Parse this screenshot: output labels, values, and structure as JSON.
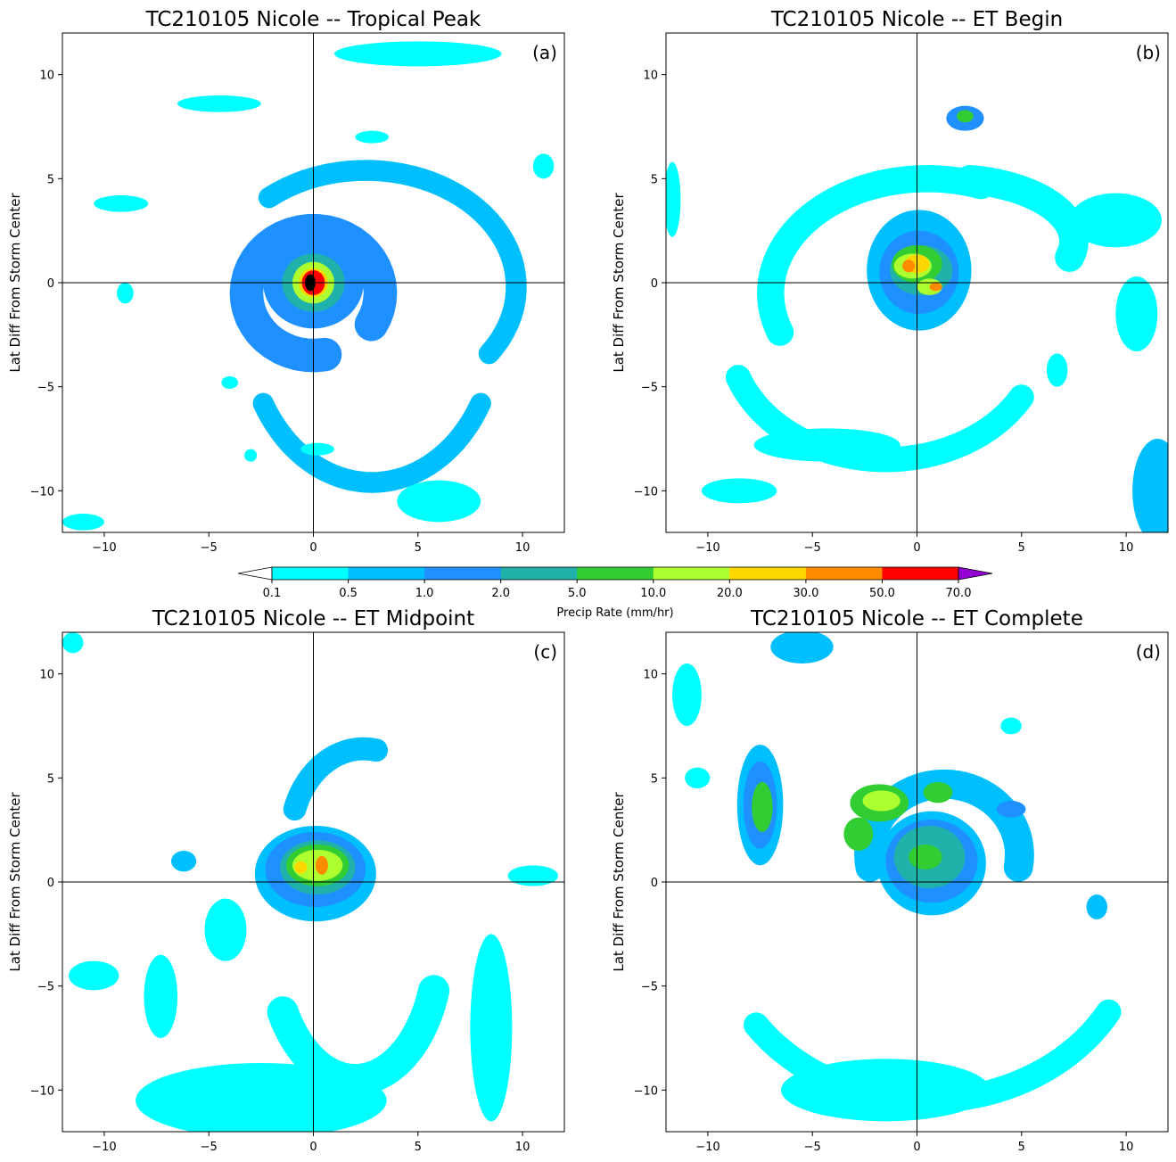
{
  "chart_data": {
    "type": "contour",
    "colorbar": {
      "label": "Precip Rate (mm/hr)",
      "levels": [
        "0.1",
        "0.5",
        "1.0",
        "2.0",
        "5.0",
        "10.0",
        "20.0",
        "30.0",
        "50.0",
        "70.0"
      ],
      "colors": [
        "#00ffff",
        "#00bfff",
        "#1e90ff",
        "#20b2aa",
        "#32cd32",
        "#adff2f",
        "#ffd700",
        "#ff8c00",
        "#ff0000"
      ],
      "under_color": "#ffffff",
      "over_color": "#9400d3",
      "extend": "both"
    },
    "panels": [
      {
        "title": "TC210105 Nicole -- Tropical Peak",
        "letter": "(a)",
        "ylabel": "Lat Diff From Storm Center",
        "xlim": [
          -12,
          12
        ],
        "ylim": [
          -12,
          12
        ],
        "xticks": [
          "−10",
          "−5",
          "0",
          "5",
          "10"
        ],
        "yticks": [
          "10",
          "5",
          "0",
          "−5",
          "−10"
        ],
        "features": [
          {
            "kind": "ring",
            "cx": 0,
            "cy": -0.5,
            "rx": 3.2,
            "ry": 3.0,
            "w": 1.6,
            "a0": -30,
            "a1": 280,
            "level": 2
          },
          {
            "kind": "ring",
            "cx": 2.5,
            "cy": -0.2,
            "rx": 7.2,
            "ry": 5.6,
            "w": 1.0,
            "a0": -35,
            "a1": 130,
            "level": 1
          },
          {
            "kind": "ring",
            "cx": 2.8,
            "cy": -2.0,
            "rx": 6.0,
            "ry": 7.6,
            "w": 1.0,
            "a0": 210,
            "a1": 330,
            "level": 1
          },
          {
            "kind": "blob",
            "cx": 0,
            "cy": 0,
            "rx": 2.4,
            "ry": 2.2,
            "level": 2
          },
          {
            "kind": "blob",
            "cx": 0,
            "cy": 0,
            "rx": 1.5,
            "ry": 1.4,
            "level": 3
          },
          {
            "kind": "blob",
            "cx": 0,
            "cy": 0,
            "rx": 1.0,
            "ry": 1.0,
            "level": 5
          },
          {
            "kind": "blob",
            "cx": 0,
            "cy": 0,
            "rx": 0.7,
            "ry": 0.7,
            "level": 6
          },
          {
            "kind": "blob",
            "cx": 0,
            "cy": 0,
            "rx": 0.55,
            "ry": 0.6,
            "level": 8
          },
          {
            "kind": "blob",
            "cx": -0.15,
            "cy": 0,
            "rx": 0.25,
            "ry": 0.4,
            "level": 9
          },
          {
            "kind": "blob",
            "cx": -4.5,
            "cy": 8.6,
            "rx": 2.0,
            "ry": 0.4,
            "level": 0
          },
          {
            "kind": "blob",
            "cx": 2.8,
            "cy": 7.0,
            "rx": 0.8,
            "ry": 0.3,
            "level": 0
          },
          {
            "kind": "blob",
            "cx": -9.2,
            "cy": 3.8,
            "rx": 1.3,
            "ry": 0.4,
            "level": 0
          },
          {
            "kind": "blob",
            "cx": -4.0,
            "cy": -4.8,
            "rx": 0.4,
            "ry": 0.3,
            "level": 0
          },
          {
            "kind": "blob",
            "cx": -9.0,
            "cy": -0.5,
            "rx": 0.4,
            "ry": 0.5,
            "level": 0
          },
          {
            "kind": "blob",
            "cx": 11.0,
            "cy": 5.6,
            "rx": 0.5,
            "ry": 0.6,
            "level": 0
          },
          {
            "kind": "blob",
            "cx": 5.0,
            "cy": 11.0,
            "rx": 4.0,
            "ry": 0.6,
            "level": 0
          },
          {
            "kind": "blob",
            "cx": 0.2,
            "cy": -8.0,
            "rx": 0.8,
            "ry": 0.3,
            "level": 0
          },
          {
            "kind": "blob",
            "cx": 6.0,
            "cy": -10.5,
            "rx": 2.0,
            "ry": 1.0,
            "level": 0
          },
          {
            "kind": "blob",
            "cx": -3.0,
            "cy": -8.3,
            "rx": 0.3,
            "ry": 0.3,
            "level": 0
          },
          {
            "kind": "blob",
            "cx": -11.0,
            "cy": -11.5,
            "rx": 1.0,
            "ry": 0.4,
            "level": 0
          }
        ]
      },
      {
        "title": "TC210105 Nicole -- ET Begin",
        "letter": "(b)",
        "ylabel": "Lat Diff From Storm Center",
        "xlim": [
          -12,
          12
        ],
        "ylim": [
          -12,
          12
        ],
        "xticks": [
          "−10",
          "−5",
          "0",
          "5",
          "10"
        ],
        "yticks": [
          "10",
          "5",
          "0",
          "−5",
          "−10"
        ],
        "features": [
          {
            "kind": "ring",
            "cx": 0.5,
            "cy": -0.5,
            "rx": 7.5,
            "ry": 5.5,
            "w": 1.3,
            "a0": 70,
            "a1": 200,
            "level": 0
          },
          {
            "kind": "ring",
            "cx": -1.5,
            "cy": -2.5,
            "rx": 7.5,
            "ry": 6.0,
            "w": 1.2,
            "a0": 200,
            "a1": 330,
            "level": 0
          },
          {
            "kind": "ring",
            "cx": 1.5,
            "cy": 2.0,
            "rx": 6.0,
            "ry": 3.0,
            "w": 1.4,
            "a0": -15,
            "a1": 80,
            "level": 0
          },
          {
            "kind": "blob",
            "cx": 0.1,
            "cy": 0.6,
            "rx": 2.5,
            "ry": 2.9,
            "level": 1
          },
          {
            "kind": "blob",
            "cx": 0.1,
            "cy": 0.5,
            "rx": 1.9,
            "ry": 2.0,
            "level": 2
          },
          {
            "kind": "blob",
            "cx": 0.2,
            "cy": 0.6,
            "rx": 1.5,
            "ry": 1.2,
            "level": 3
          },
          {
            "kind": "blob",
            "cx": 0.0,
            "cy": 0.9,
            "rx": 1.2,
            "ry": 0.9,
            "level": 4
          },
          {
            "kind": "blob",
            "cx": -0.2,
            "cy": 0.8,
            "rx": 0.9,
            "ry": 0.6,
            "level": 5
          },
          {
            "kind": "blob",
            "cx": 0.6,
            "cy": -0.2,
            "rx": 0.6,
            "ry": 0.4,
            "level": 5
          },
          {
            "kind": "blob",
            "cx": 0.0,
            "cy": 0.9,
            "rx": 0.6,
            "ry": 0.45,
            "level": 6
          },
          {
            "kind": "blob",
            "cx": -0.4,
            "cy": 0.8,
            "rx": 0.3,
            "ry": 0.3,
            "level": 7
          },
          {
            "kind": "blob",
            "cx": 0.9,
            "cy": -0.2,
            "rx": 0.3,
            "ry": 0.2,
            "level": 7
          },
          {
            "kind": "blob",
            "cx": 2.3,
            "cy": 7.9,
            "rx": 0.9,
            "ry": 0.6,
            "level": 2
          },
          {
            "kind": "blob",
            "cx": 2.3,
            "cy": 8.0,
            "rx": 0.4,
            "ry": 0.3,
            "level": 4
          },
          {
            "kind": "blob",
            "cx": 10.5,
            "cy": -1.5,
            "rx": 1.0,
            "ry": 1.8,
            "level": 0
          },
          {
            "kind": "blob",
            "cx": 11.5,
            "cy": -10.0,
            "rx": 1.2,
            "ry": 2.5,
            "level": 1
          },
          {
            "kind": "blob",
            "cx": -4.3,
            "cy": -7.8,
            "rx": 3.5,
            "ry": 0.8,
            "level": 0
          },
          {
            "kind": "blob",
            "cx": -8.5,
            "cy": -10.0,
            "rx": 1.8,
            "ry": 0.6,
            "level": 0
          },
          {
            "kind": "blob",
            "cx": -11.7,
            "cy": 4.0,
            "rx": 0.4,
            "ry": 1.8,
            "level": 0
          },
          {
            "kind": "blob",
            "cx": 6.7,
            "cy": -4.2,
            "rx": 0.5,
            "ry": 0.8,
            "level": 0
          },
          {
            "kind": "blob",
            "cx": 9.5,
            "cy": 3.0,
            "rx": 2.2,
            "ry": 1.3,
            "level": 0
          }
        ]
      },
      {
        "title": "TC210105 Nicole -- ET Midpoint",
        "letter": "(c)",
        "ylabel": "Lat Diff From Storm Center",
        "xlim": [
          -12,
          12
        ],
        "ylim": [
          -12,
          12
        ],
        "xticks": [
          "−10",
          "−5",
          "0",
          "5",
          "10"
        ],
        "yticks": [
          "10",
          "5",
          "0",
          "−5",
          "−10"
        ],
        "features": [
          {
            "kind": "ring",
            "cx": 2.4,
            "cy": 2.0,
            "rx": 3.5,
            "ry": 4.4,
            "w": 1.1,
            "a0": 80,
            "a1": 160,
            "level": 1
          },
          {
            "kind": "ring",
            "cx": 2.0,
            "cy": -3.0,
            "rx": 4.0,
            "ry": 6.5,
            "w": 1.5,
            "a0": 210,
            "a1": 340,
            "level": 0
          },
          {
            "kind": "blob",
            "cx": 0.1,
            "cy": 0.4,
            "rx": 2.9,
            "ry": 2.3,
            "level": 1
          },
          {
            "kind": "blob",
            "cx": 0.1,
            "cy": 0.6,
            "rx": 2.4,
            "ry": 1.8,
            "level": 2
          },
          {
            "kind": "blob",
            "cx": 0.2,
            "cy": 0.7,
            "rx": 1.8,
            "ry": 1.3,
            "level": 3
          },
          {
            "kind": "blob",
            "cx": 0.2,
            "cy": 0.8,
            "rx": 1.5,
            "ry": 1.0,
            "level": 4
          },
          {
            "kind": "blob",
            "cx": 0.2,
            "cy": 0.8,
            "rx": 1.2,
            "ry": 0.75,
            "level": 5
          },
          {
            "kind": "blob",
            "cx": -0.6,
            "cy": 0.7,
            "rx": 0.3,
            "ry": 0.3,
            "level": 6
          },
          {
            "kind": "blob",
            "cx": 0.4,
            "cy": 0.8,
            "rx": 0.3,
            "ry": 0.45,
            "level": 7
          },
          {
            "kind": "blob",
            "cx": -6.2,
            "cy": 1.0,
            "rx": 0.6,
            "ry": 0.5,
            "level": 1
          },
          {
            "kind": "blob",
            "cx": -10.5,
            "cy": -4.5,
            "rx": 1.2,
            "ry": 0.7,
            "level": 0
          },
          {
            "kind": "blob",
            "cx": -7.3,
            "cy": -5.5,
            "rx": 0.8,
            "ry": 2.0,
            "level": 0
          },
          {
            "kind": "blob",
            "cx": -2.5,
            "cy": -10.5,
            "rx": 6.0,
            "ry": 1.8,
            "level": 0
          },
          {
            "kind": "blob",
            "cx": 8.5,
            "cy": -7.0,
            "rx": 1.0,
            "ry": 4.5,
            "level": 0
          },
          {
            "kind": "blob",
            "cx": 10.5,
            "cy": 0.3,
            "rx": 1.2,
            "ry": 0.5,
            "level": 0
          },
          {
            "kind": "blob",
            "cx": -11.5,
            "cy": 11.5,
            "rx": 0.5,
            "ry": 0.5,
            "level": 0
          },
          {
            "kind": "blob",
            "cx": -4.2,
            "cy": -2.3,
            "rx": 1.0,
            "ry": 1.5,
            "level": 0
          }
        ]
      },
      {
        "title": "TC210105 Nicole -- ET Complete",
        "letter": "(d)",
        "ylabel": "Lat Diff From Storm Center",
        "xlim": [
          -12,
          12
        ],
        "ylim": [
          -12,
          12
        ],
        "xticks": [
          "−10",
          "−5",
          "0",
          "5",
          "10"
        ],
        "yticks": [
          "10",
          "5",
          "0",
          "−5",
          "−10"
        ],
        "features": [
          {
            "kind": "ring",
            "cx": 1.3,
            "cy": 1.3,
            "rx": 3.6,
            "ry": 3.4,
            "w": 1.4,
            "a0": -10,
            "a1": 190,
            "level": 1
          },
          {
            "kind": "ring",
            "cx": 0.5,
            "cy": -2.0,
            "rx": 10.0,
            "ry": 8.5,
            "w": 1.2,
            "a0": 215,
            "a1": 330,
            "level": 0
          },
          {
            "kind": "blob",
            "cx": 0.7,
            "cy": 0.9,
            "rx": 2.6,
            "ry": 2.5,
            "level": 1
          },
          {
            "kind": "blob",
            "cx": 0.7,
            "cy": 1.0,
            "rx": 2.2,
            "ry": 2.0,
            "level": 2
          },
          {
            "kind": "blob",
            "cx": 0.6,
            "cy": 1.2,
            "rx": 1.7,
            "ry": 1.5,
            "level": 3
          },
          {
            "kind": "blob",
            "cx": 0.4,
            "cy": 1.2,
            "rx": 0.8,
            "ry": 0.6,
            "level": 4
          },
          {
            "kind": "blob",
            "cx": -1.8,
            "cy": 3.8,
            "rx": 1.4,
            "ry": 0.9,
            "level": 4
          },
          {
            "kind": "blob",
            "cx": -1.7,
            "cy": 3.9,
            "rx": 0.9,
            "ry": 0.5,
            "level": 5
          },
          {
            "kind": "blob",
            "cx": -2.8,
            "cy": 2.3,
            "rx": 0.7,
            "ry": 0.8,
            "level": 4
          },
          {
            "kind": "blob",
            "cx": 1.0,
            "cy": 4.3,
            "rx": 0.7,
            "ry": 0.5,
            "level": 4
          },
          {
            "kind": "blob",
            "cx": -7.5,
            "cy": 3.7,
            "rx": 1.1,
            "ry": 2.9,
            "level": 1
          },
          {
            "kind": "blob",
            "cx": -7.5,
            "cy": 3.7,
            "rx": 0.8,
            "ry": 2.1,
            "level": 2
          },
          {
            "kind": "blob",
            "cx": -7.4,
            "cy": 3.6,
            "rx": 0.5,
            "ry": 1.2,
            "level": 4
          },
          {
            "kind": "blob",
            "cx": -5.5,
            "cy": 11.3,
            "rx": 1.5,
            "ry": 0.8,
            "level": 1
          },
          {
            "kind": "blob",
            "cx": -11.0,
            "cy": 9.0,
            "rx": 0.7,
            "ry": 1.5,
            "level": 0
          },
          {
            "kind": "blob",
            "cx": -10.5,
            "cy": 5.0,
            "rx": 0.6,
            "ry": 0.5,
            "level": 0
          },
          {
            "kind": "blob",
            "cx": 8.6,
            "cy": -1.2,
            "rx": 0.5,
            "ry": 0.6,
            "level": 1
          },
          {
            "kind": "blob",
            "cx": 4.5,
            "cy": 3.5,
            "rx": 0.7,
            "ry": 0.4,
            "level": 2
          },
          {
            "kind": "blob",
            "cx": 4.5,
            "cy": 7.5,
            "rx": 0.5,
            "ry": 0.4,
            "level": 0
          },
          {
            "kind": "blob",
            "cx": -1.5,
            "cy": -10.0,
            "rx": 5.0,
            "ry": 1.5,
            "level": 0
          }
        ]
      }
    ]
  }
}
